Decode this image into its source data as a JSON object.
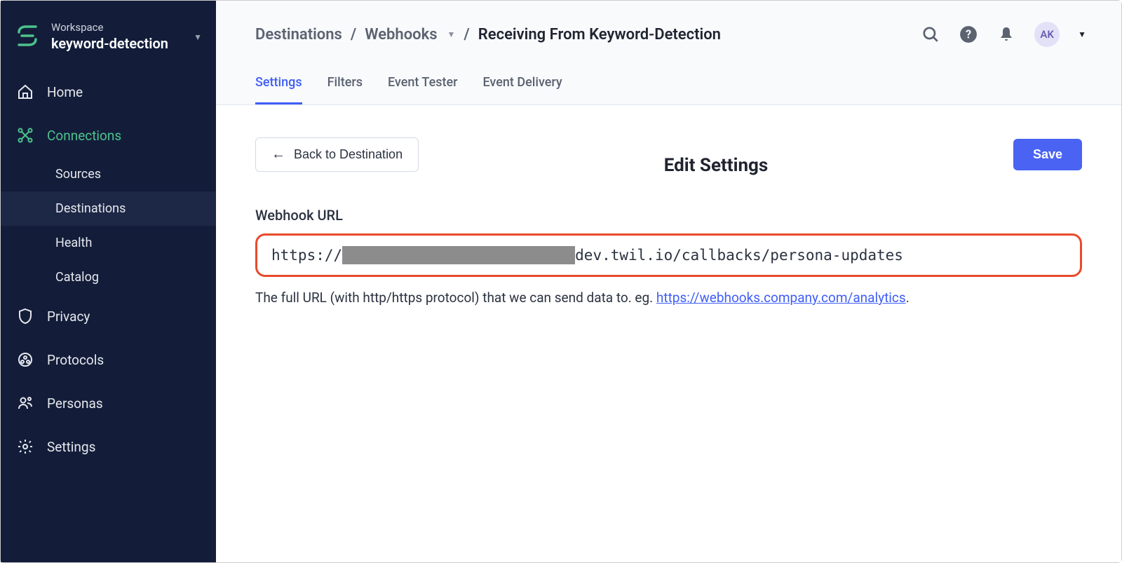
{
  "workspace": {
    "label": "Workspace",
    "name": "keyword-detection"
  },
  "sidebar": {
    "items": [
      {
        "id": "home",
        "label": "Home"
      },
      {
        "id": "connections",
        "label": "Connections",
        "active": true,
        "sub": [
          {
            "id": "sources",
            "label": "Sources"
          },
          {
            "id": "destinations",
            "label": "Destinations",
            "selected": true
          },
          {
            "id": "health",
            "label": "Health"
          },
          {
            "id": "catalog",
            "label": "Catalog"
          }
        ]
      },
      {
        "id": "privacy",
        "label": "Privacy"
      },
      {
        "id": "protocols",
        "label": "Protocols"
      },
      {
        "id": "personas",
        "label": "Personas"
      },
      {
        "id": "settings",
        "label": "Settings"
      }
    ]
  },
  "breadcrumb": {
    "root": "Destinations",
    "mid": "Webhooks",
    "current": "Receiving From Keyword-Detection"
  },
  "user": {
    "initials": "AK"
  },
  "tabs": [
    {
      "id": "settings",
      "label": "Settings",
      "active": true
    },
    {
      "id": "filters",
      "label": "Filters"
    },
    {
      "id": "event-tester",
      "label": "Event Tester"
    },
    {
      "id": "event-delivery",
      "label": "Event Delivery"
    }
  ],
  "page": {
    "back_label": "Back to Destination",
    "title": "Edit Settings",
    "save_label": "Save",
    "field_label": "Webhook URL",
    "url_prefix": "https://",
    "url_suffix": "dev.twil.io/callbacks/persona-updates",
    "helper_pre": "The full URL (with http/https protocol) that we can send data to. eg. ",
    "helper_link": "https://webhooks.company.com/analytics",
    "helper_post": "."
  }
}
